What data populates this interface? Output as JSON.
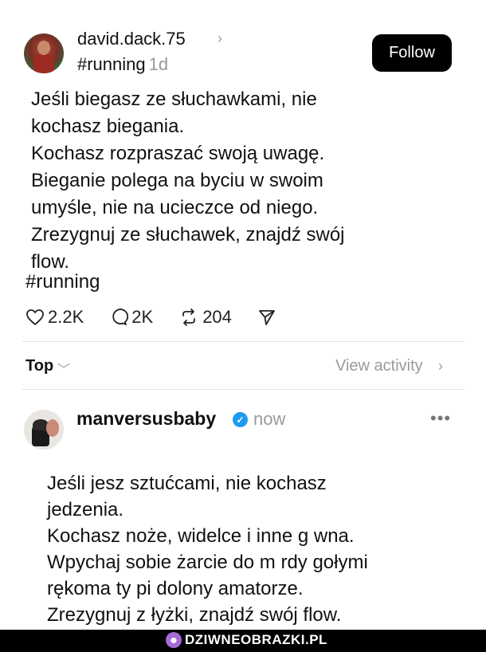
{
  "post": {
    "username": "david.dack.75",
    "hashtag_heading": "#running",
    "age": "1d",
    "follow_label": "Follow",
    "body": "Jeśli biegasz ze słuchawkami, nie\nkochasz biegania.\nKochasz rozpraszać swoją uwagę.\nBieganie polega na byciu w swoim\numyśle, nie na ucieczce od niego.\nZrezygnuj ze słuchawek, znajdź swój\nflow.",
    "hashtag": "#running",
    "likes": "2.2K",
    "comments": "2K",
    "reposts": "204"
  },
  "sort": {
    "label": "Top",
    "view_activity": "View activity"
  },
  "reply": {
    "username": "manversusbaby",
    "time": "now",
    "more": "•••",
    "body": "Jeśli jesz sztućcami, nie kochasz\njedzenia.\nKochasz noże, widelce i inne g wna.\nWpychaj sobie żarcie do m rdy gołymi\nrękoma ty pi dolony amatorze.\nZrezygnuj z łyżki, znajdź swój flow."
  },
  "footer": {
    "brand": "DZIWNEOBRAZKI.PL"
  },
  "icons": {
    "like": "heart-icon",
    "comment": "comment-bubble-icon",
    "repost": "repost-icon",
    "share": "send-icon",
    "verified": "verified-badge-icon"
  },
  "colors": {
    "follow_bg": "#000000",
    "muted": "#9a9a9a",
    "verified": "#1d9bf0",
    "brand_logo": "#a36bd6"
  }
}
